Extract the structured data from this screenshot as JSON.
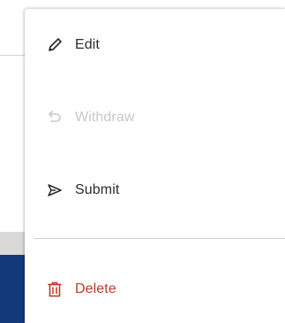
{
  "menu": {
    "items": [
      {
        "label": "Edit",
        "icon": "pencil-icon",
        "enabled": true
      },
      {
        "label": "Withdraw",
        "icon": "undo-icon",
        "enabled": false
      },
      {
        "label": "Submit",
        "icon": "send-icon",
        "enabled": true
      },
      {
        "label": "Delete",
        "icon": "trash-icon",
        "enabled": true,
        "destructive": true
      }
    ]
  },
  "colors": {
    "text": "#2b2b2b",
    "disabled": "#c9c9c9",
    "danger": "#c0392b",
    "divider": "#cfcfcf",
    "background_accent": "#123a7a"
  }
}
